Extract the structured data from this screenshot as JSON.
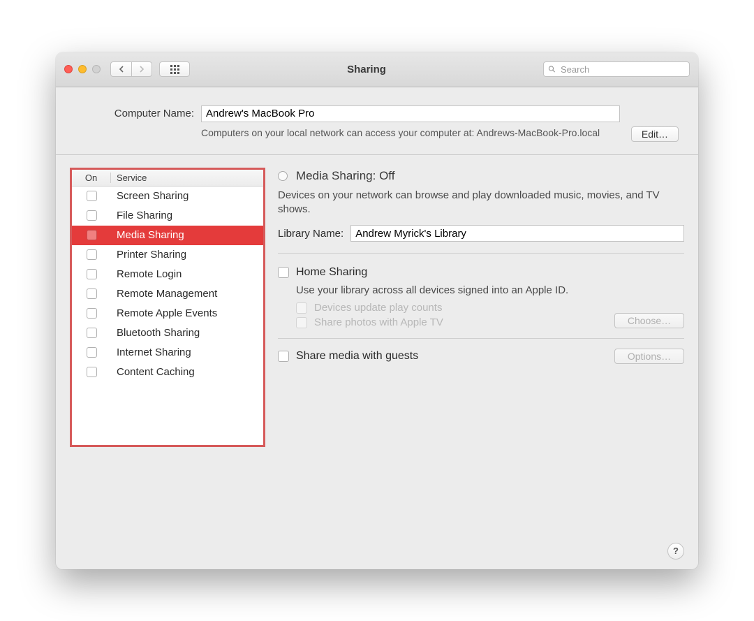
{
  "window": {
    "title": "Sharing"
  },
  "search": {
    "placeholder": "Search"
  },
  "computerName": {
    "label": "Computer Name:",
    "value": "Andrew's MacBook Pro",
    "description": "Computers on your local network can access your computer at: Andrews-MacBook-Pro.local",
    "editButton": "Edit…"
  },
  "serviceTable": {
    "header_on": "On",
    "header_service": "Service",
    "items": [
      {
        "label": "Screen Sharing"
      },
      {
        "label": "File Sharing"
      },
      {
        "label": "Media Sharing"
      },
      {
        "label": "Printer Sharing"
      },
      {
        "label": "Remote Login"
      },
      {
        "label": "Remote Management"
      },
      {
        "label": "Remote Apple Events"
      },
      {
        "label": "Bluetooth Sharing"
      },
      {
        "label": "Internet Sharing"
      },
      {
        "label": "Content Caching"
      }
    ]
  },
  "details": {
    "status": "Media Sharing: Off",
    "statusDesc": "Devices on your network can browse and play downloaded music, movies, and TV shows.",
    "libraryLabel": "Library Name:",
    "libraryValue": "Andrew Myrick's Library",
    "homeSharing": "Home Sharing",
    "homeSharingDesc": "Use your library across all devices signed into an Apple ID.",
    "playCounts": "Devices update play counts",
    "sharePhotos": "Share photos with Apple TV",
    "chooseButton": "Choose…",
    "guests": "Share media with guests",
    "optionsButton": "Options…"
  },
  "help": {
    "label": "?"
  }
}
